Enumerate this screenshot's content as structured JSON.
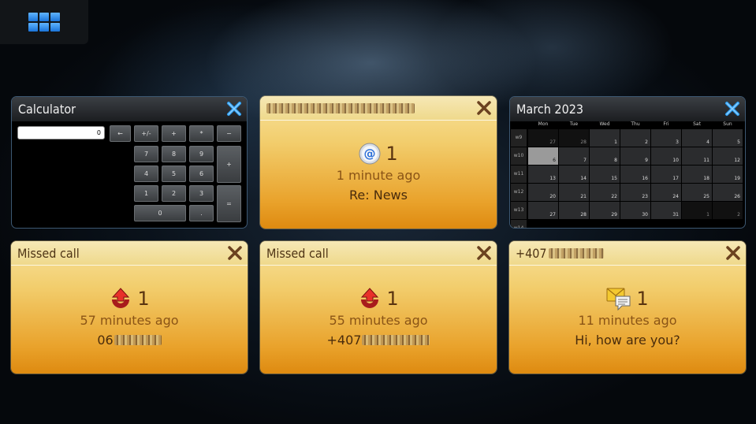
{
  "app_switcher": {
    "icon": "grid-icon"
  },
  "calculator": {
    "title": "Calculator",
    "display": "0",
    "keys": [
      "←",
      "+/-",
      "+",
      "*",
      "−",
      "7",
      "8",
      "9",
      "+",
      "4",
      "5",
      "6",
      "1",
      "2",
      "3",
      "=",
      "0",
      "."
    ]
  },
  "email": {
    "sender": "",
    "count": "1",
    "time": "1 minute ago",
    "subject": "Re: News",
    "icon": "email-at-icon"
  },
  "calendar": {
    "title": "March 2023",
    "days": [
      "Mon",
      "Tue",
      "Wed",
      "Thu",
      "Fri",
      "Sat",
      "Sun"
    ],
    "weeks": [
      "w9",
      "w10",
      "w11",
      "w12",
      "w13",
      "w14"
    ],
    "dates": [
      [
        "27",
        "28",
        "1",
        "2",
        "3",
        "4",
        "5"
      ],
      [
        "6",
        "7",
        "8",
        "9",
        "10",
        "11",
        "12"
      ],
      [
        "13",
        "14",
        "15",
        "16",
        "17",
        "18",
        "19"
      ],
      [
        "20",
        "21",
        "22",
        "23",
        "24",
        "25",
        "26"
      ],
      [
        "27",
        "28",
        "29",
        "30",
        "31",
        "1",
        "2"
      ]
    ]
  },
  "missed_call_1": {
    "title": "Missed call",
    "count": "1",
    "time": "57 minutes ago",
    "number": "06"
  },
  "missed_call_2": {
    "title": "Missed call",
    "count": "1",
    "time": "55 minutes ago",
    "number": "+407"
  },
  "sms": {
    "title": "+407",
    "count": "1",
    "time": "11 minutes ago",
    "message": "Hi, how are you?",
    "icon": "message-icon"
  },
  "colors": {
    "gold_top": "#f7e39e",
    "gold_bottom": "#de8a10",
    "close_blue": "#2c9df0",
    "close_brown": "#6b4220"
  }
}
